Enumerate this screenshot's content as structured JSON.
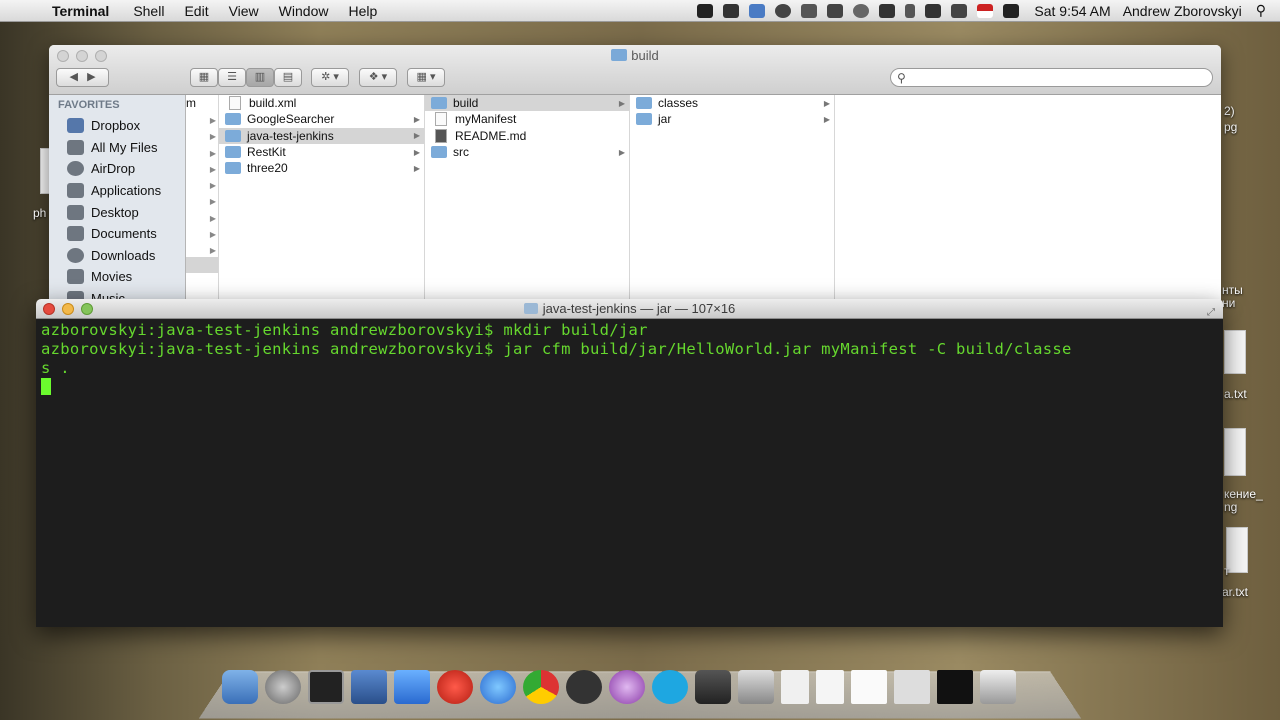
{
  "menubar": {
    "app_name": "Terminal",
    "menus": [
      "Shell",
      "Edit",
      "View",
      "Window",
      "Help"
    ],
    "clock": "Sat 9:54 AM",
    "user": "Andrew Zborovskyi"
  },
  "desktop_labels": [
    "ph",
    "2)",
    "pg",
    "нты",
    "ни",
    "a.txt",
    "кение_",
    "ng",
    "т",
    "ar.txt"
  ],
  "finder": {
    "title": "build",
    "search_placeholder": "",
    "sidebar": {
      "heading": "FAVORITES",
      "items": [
        {
          "label": "Dropbox",
          "icon": "dropbox-icon"
        },
        {
          "label": "All My Files",
          "icon": "all-files-icon"
        },
        {
          "label": "AirDrop",
          "icon": "airdrop-icon"
        },
        {
          "label": "Applications",
          "icon": "applications-icon"
        },
        {
          "label": "Desktop",
          "icon": "desktop-icon"
        },
        {
          "label": "Documents",
          "icon": "documents-icon"
        },
        {
          "label": "Downloads",
          "icon": "downloads-icon"
        },
        {
          "label": "Movies",
          "icon": "movies-icon"
        },
        {
          "label": "Music",
          "icon": "music-icon"
        }
      ]
    },
    "column0_label": "m",
    "column1": [
      "build.xml",
      "GoogleSearcher",
      "java-test-jenkins",
      "RestKit",
      "three20"
    ],
    "column2": [
      "build",
      "myManifest",
      "README.md",
      "src"
    ],
    "column3": [
      "classes",
      "jar"
    ]
  },
  "terminal": {
    "title": "java-test-jenkins — jar — 107×16",
    "lines": [
      "azborovskyi:java-test-jenkins andrewzborovskyi$ mkdir build/jar",
      "azborovskyi:java-test-jenkins andrewzborovskyi$ jar cfm build/jar/HelloWorld.jar myManifest -C build/classe",
      "s ."
    ]
  }
}
